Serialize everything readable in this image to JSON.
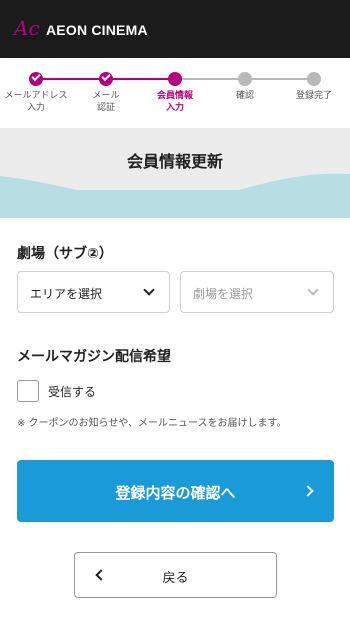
{
  "header": {
    "logo_mark": "Ac",
    "logo_text": "AEON CINEMA"
  },
  "steps": [
    {
      "label": "メールアドレス\n入力",
      "state": "done"
    },
    {
      "label": "メール\n認証",
      "state": "done"
    },
    {
      "label": "会員情報\n入力",
      "state": "current"
    },
    {
      "label": "確認",
      "state": "todo"
    },
    {
      "label": "登録完了",
      "state": "todo"
    }
  ],
  "colors": {
    "accent": "#b5007e",
    "primary_button": "#1a9ad6",
    "wave": "#b7dfe3"
  },
  "page_title": "会員情報更新",
  "theater_section": {
    "label": "劇場（サブ②）",
    "area_select": {
      "value": "エリアを選択"
    },
    "theater_select": {
      "value": "劇場を選択"
    }
  },
  "magazine_section": {
    "label": "メールマガジン配信希望",
    "checkbox_label": "受信する",
    "checked": false,
    "note": "※ クーポンのお知らせや、メールニュースをお届けします。"
  },
  "buttons": {
    "confirm": "登録内容の確認へ",
    "back": "戻る"
  }
}
